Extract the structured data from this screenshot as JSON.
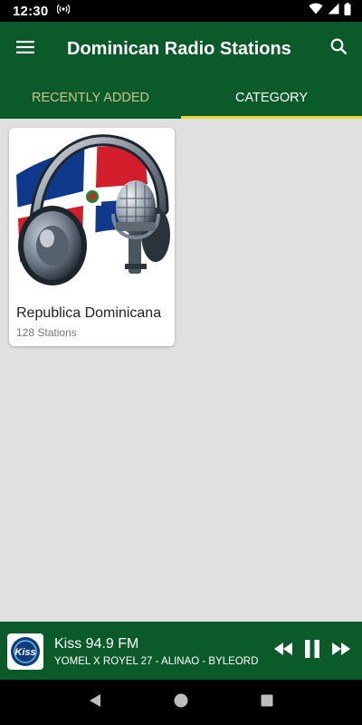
{
  "status_bar": {
    "time": "12:30"
  },
  "app_bar": {
    "title": "Dominican Radio Stations",
    "menu_icon": "hamburger-menu-icon",
    "search_icon": "search-icon"
  },
  "tabs": [
    {
      "label": "RECENTLY ADDED",
      "selected": false
    },
    {
      "label": "CATEGORY",
      "selected": true
    }
  ],
  "categories": [
    {
      "title": "Republica Dominicana",
      "subtitle": "128 Stations"
    }
  ],
  "player": {
    "station": "Kiss 94.9 FM",
    "track": "YOMEL X ROYEL 27 - ALINAO - BYLEORD",
    "logo_text": "Kiss",
    "state": "playing"
  },
  "colors": {
    "primary": "#0b5b2a",
    "tab_indicator": "#e7d63a",
    "tab_inactive_text": "#c9c48a",
    "background": "#e0e0e0"
  }
}
